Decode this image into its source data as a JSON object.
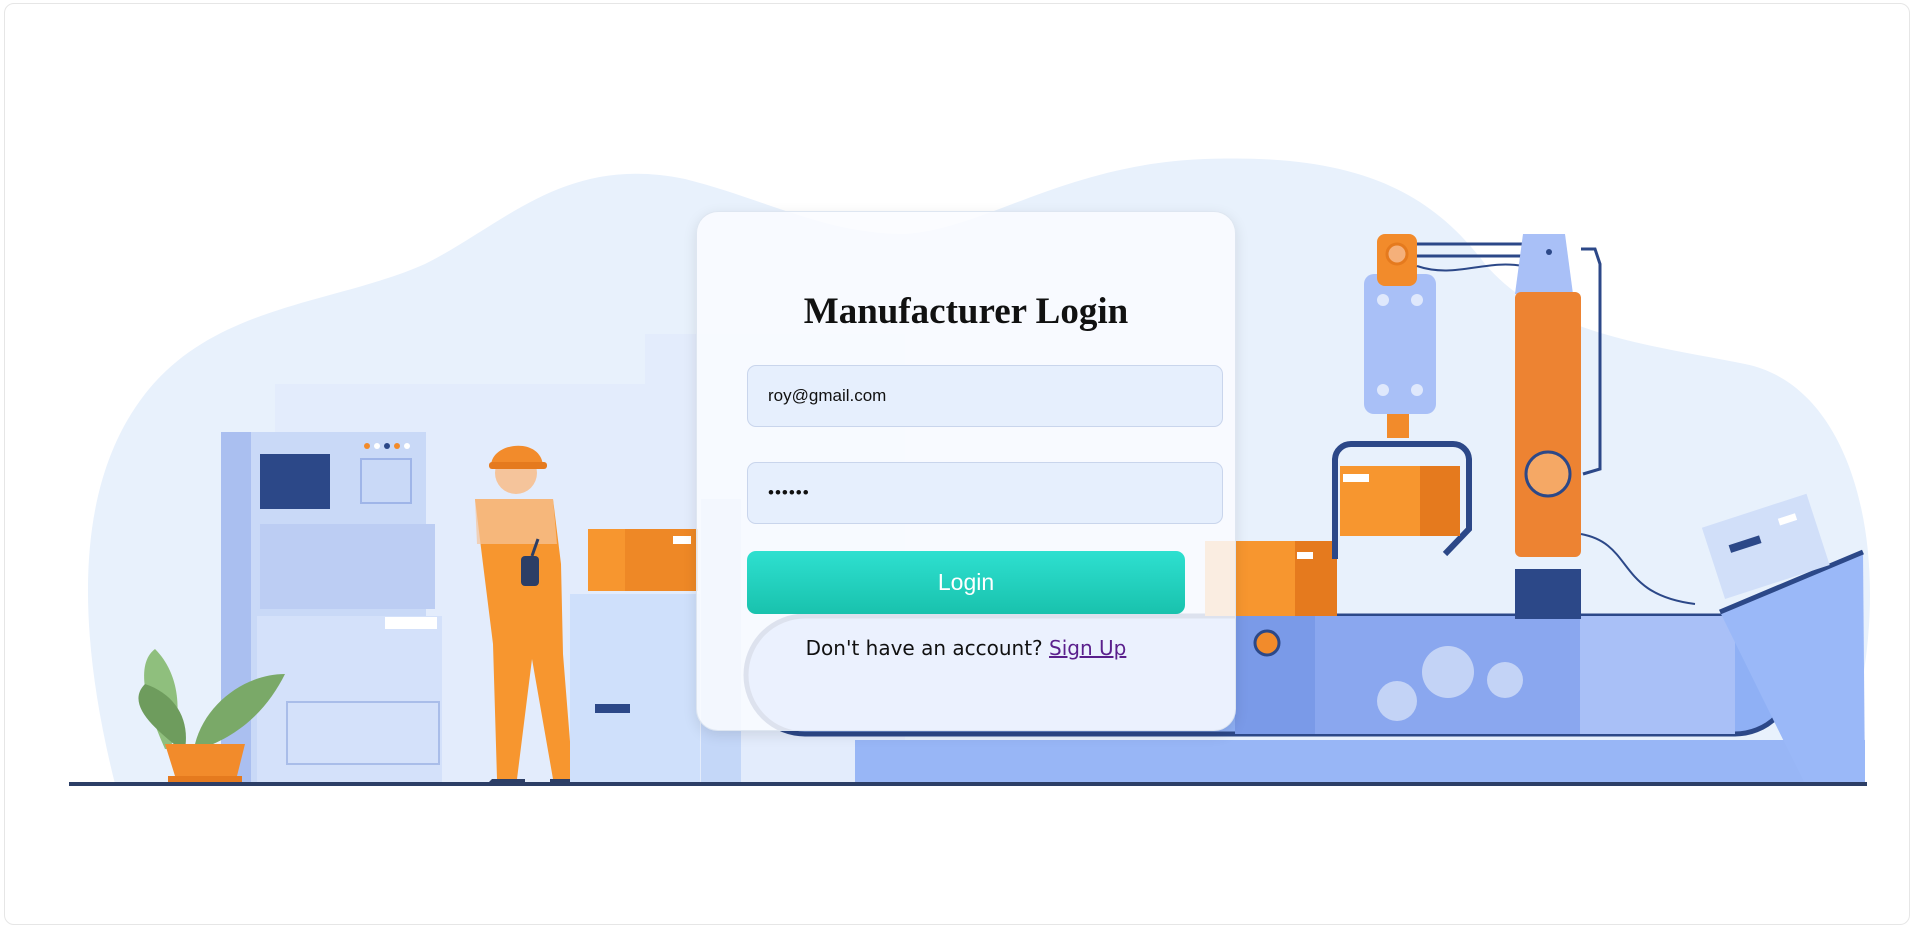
{
  "login": {
    "title": "Manufacturer Login",
    "email_value": "roy@gmail.com",
    "password_value": "••••••",
    "login_button_label": "Login",
    "signup_prompt": "Don't have an account?",
    "signup_link_label": "Sign Up"
  },
  "colors": {
    "button_gradient_top": "#2ee0d0",
    "button_gradient_bottom": "#19c2ad",
    "input_background": "#e6effd",
    "link_color": "#5a1f8c",
    "worker_orange": "#f28b2b",
    "conveyor_blue": "#8fb0f5"
  }
}
